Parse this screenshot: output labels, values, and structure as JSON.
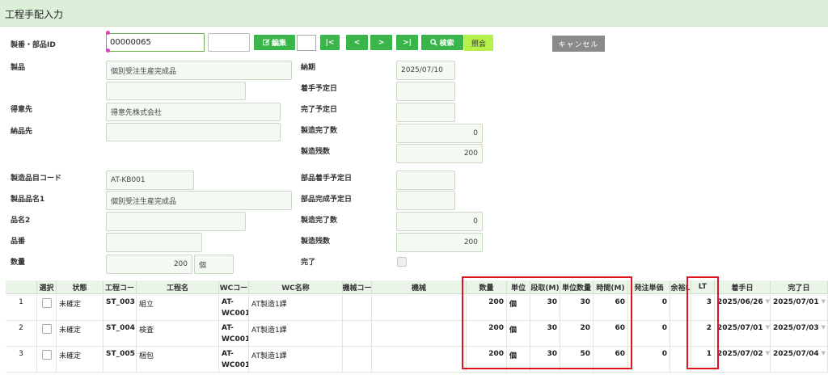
{
  "window": {
    "title": "工程手配入力"
  },
  "header": {
    "id_label": "製番・部品ID",
    "id_value": "00000065",
    "id_sub_value": "",
    "edit_button": "編集",
    "first_button": "|<",
    "prev_button": "<",
    "next_button": ">",
    "last_button": ">|",
    "search_button": "検索",
    "inquiry_button": "照会",
    "cancel_button": "キャンセル"
  },
  "form_left": {
    "product_label": "製品",
    "product_value": "個別受注生産完成品",
    "product_value2": "",
    "customer_label": "得意先",
    "customer_value": "得意先株式会社",
    "delivery_label": "納品先",
    "delivery_value": "",
    "item_code_label": "製造品目コード",
    "item_code_value": "AT-KB001",
    "item_name1_label": "製品品名1",
    "item_name1_value": "個別受注生産完成品",
    "item_name2_label": "品名2",
    "item_name2_value": "",
    "part_no_label": "品番",
    "part_no_value": "",
    "qty_label": "数量",
    "qty_value": "200",
    "qty_unit": "個"
  },
  "form_right": {
    "due_label": "納期",
    "due_value": "2025/07/10",
    "start_plan_label": "着手予定日",
    "start_plan_value": "",
    "finish_plan_label": "完了予定日",
    "finish_plan_value": "",
    "mfg_done_label": "製造完了数",
    "mfg_done_value": "0",
    "mfg_remain_label": "製造残数",
    "mfg_remain_value": "200",
    "part_start_label": "部品着手予定日",
    "part_start_value": "",
    "part_finish_label": "部品完成予定日",
    "part_finish_value": "",
    "mfg_done2_label": "製造完了数",
    "mfg_done2_value": "0",
    "mfg_remain2_label": "製造残数",
    "mfg_remain2_value": "200",
    "complete_label": "完了"
  },
  "grid": {
    "columns": [
      "選択",
      "状態",
      "工程コー",
      "工程名",
      "WCコー",
      "WC名称",
      "機械コー",
      "機械",
      "数量",
      "単位",
      "段取(M)",
      "単位数量",
      "時間(M)",
      "発注単価",
      "余裕L",
      "LT",
      "着手日",
      "完了日"
    ],
    "rows": [
      {
        "no": "1",
        "status": "未確定",
        "proc_code": "ST_003",
        "proc_name": "組立",
        "wc_code": "AT-WC001",
        "wc_name": "AT製造1課",
        "mc_code": "",
        "machine": "",
        "qty": "200",
        "unit": "個",
        "setup": "30",
        "unit_qty": "30",
        "time": "60",
        "price": "0",
        "slack": "",
        "lt": "3",
        "start": "2025/06/26",
        "end": "2025/07/01"
      },
      {
        "no": "2",
        "status": "未確定",
        "proc_code": "ST_004",
        "proc_name": "検査",
        "wc_code": "AT-WC001",
        "wc_name": "AT製造1課",
        "mc_code": "",
        "machine": "",
        "qty": "200",
        "unit": "個",
        "setup": "30",
        "unit_qty": "20",
        "time": "60",
        "price": "0",
        "slack": "",
        "lt": "2",
        "start": "2025/07/01",
        "end": "2025/07/03"
      },
      {
        "no": "3",
        "status": "未確定",
        "proc_code": "ST_005",
        "proc_name": "梱包",
        "wc_code": "AT-WC001",
        "wc_name": "AT製造1課",
        "mc_code": "",
        "machine": "",
        "qty": "200",
        "unit": "個",
        "setup": "30",
        "unit_qty": "50",
        "time": "60",
        "price": "0",
        "slack": "",
        "lt": "1",
        "start": "2025/07/02",
        "end": "2025/07/04"
      }
    ]
  },
  "colors": {
    "accent_green": "#39b54a",
    "title_bg": "#dcefd9",
    "highlight_red": "#e0141f",
    "inquiry_yellow_green": "#b6f04a",
    "cancel_gray": "#8a8a8a"
  },
  "icons": [
    "edit-icon",
    "search-icon",
    "dropdown-caret-icon"
  ]
}
